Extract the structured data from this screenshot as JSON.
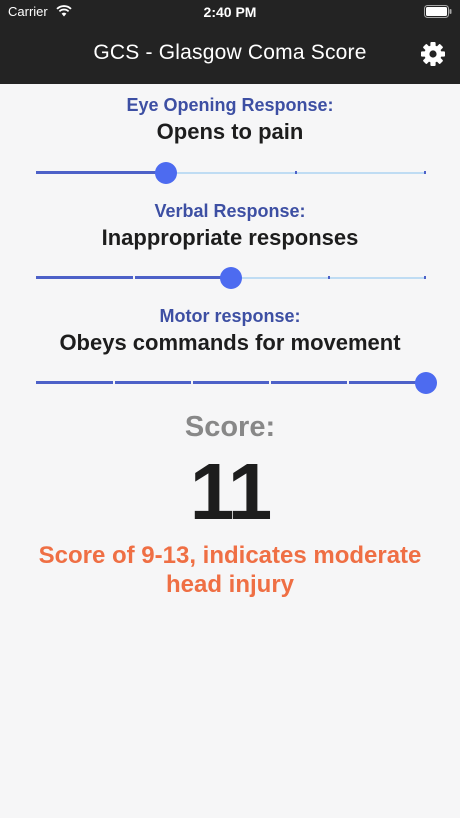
{
  "status_bar": {
    "carrier": "Carrier",
    "time": "2:40 PM",
    "icons": [
      "wifi-icon",
      "battery-icon"
    ]
  },
  "nav": {
    "title": "GCS - Glasgow Coma Score",
    "settings_icon": "gear-icon"
  },
  "sections": [
    {
      "label": "Eye Opening Response:",
      "value": "Opens to pain",
      "slider": {
        "min": 1,
        "max": 4,
        "value": 2
      }
    },
    {
      "label": "Verbal Response:",
      "value": "Inappropriate responses",
      "slider": {
        "min": 1,
        "max": 5,
        "value": 3
      }
    },
    {
      "label": "Motor response:",
      "value": "Obeys commands for movement",
      "slider": {
        "min": 1,
        "max": 6,
        "value": 6
      }
    }
  ],
  "score": {
    "label": "Score:",
    "value": "11",
    "message": "Score of 9-13, indicates moderate head injury"
  },
  "colors": {
    "accent": "#4d6bf0",
    "label": "#3d4fa3",
    "message": "#ef6f44",
    "bar": "#232323"
  }
}
